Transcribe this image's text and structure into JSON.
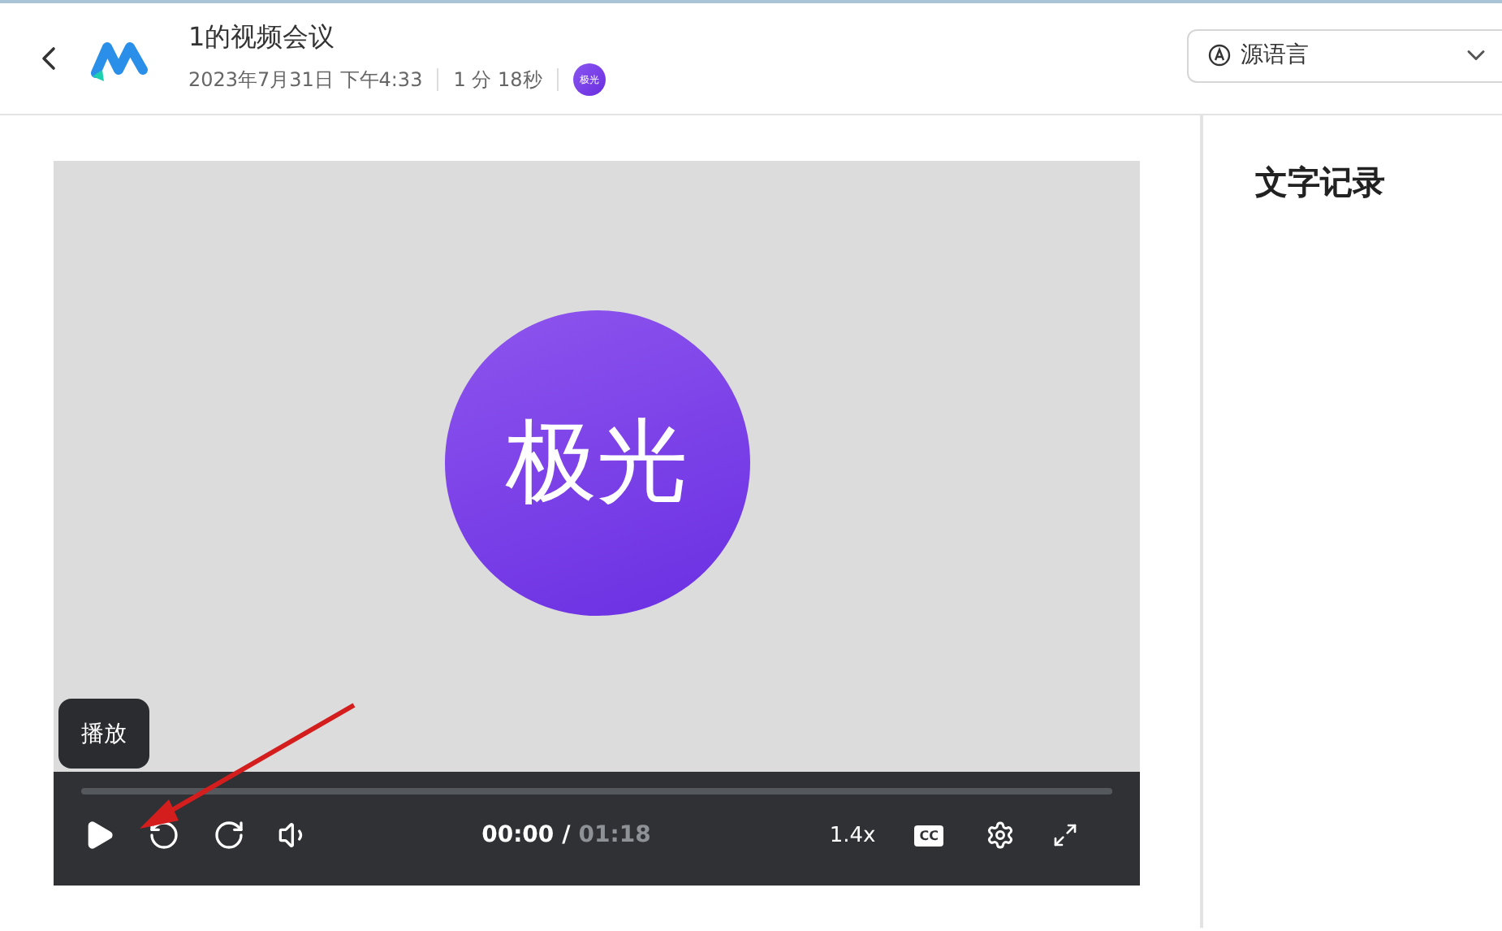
{
  "header": {
    "title": "1的视频会议",
    "date": "2023年7月31日 下午4:33",
    "duration": "1 分 18秒",
    "avatar_text": "极光"
  },
  "language_select": {
    "value": "源语言"
  },
  "video": {
    "avatar_text": "极光",
    "tooltip": "播放",
    "current_time": "00:00",
    "separator": "/",
    "total_time": "01:18",
    "speed": "1.4x",
    "captions": "CC"
  },
  "transcript_panel": {
    "title": "文字记录"
  }
}
